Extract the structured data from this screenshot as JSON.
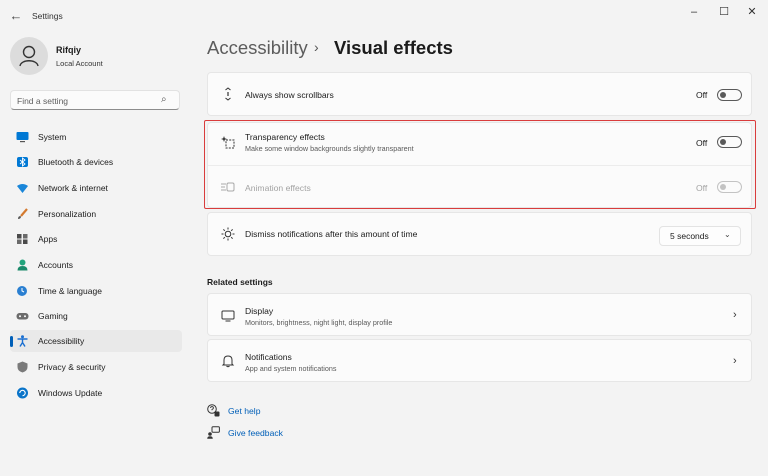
{
  "window": {
    "title": "Settings",
    "controls": [
      "minimize-icon",
      "maximize-icon",
      "close-icon"
    ]
  },
  "profile": {
    "name": "Rifqiy",
    "account_type": "Local Account"
  },
  "search": {
    "placeholder": "Find a setting"
  },
  "nav": {
    "items": [
      {
        "label": "System",
        "icon": "monitor-icon",
        "color": "#0078d4"
      },
      {
        "label": "Bluetooth & devices",
        "icon": "bluetooth-icon",
        "color": "#0078d4"
      },
      {
        "label": "Network & internet",
        "icon": "wifi-icon",
        "color": "#1a86d9"
      },
      {
        "label": "Personalization",
        "icon": "brush-icon",
        "color": "#d47a2f"
      },
      {
        "label": "Apps",
        "icon": "apps-icon",
        "color": "#4a4a4a"
      },
      {
        "label": "Accounts",
        "icon": "person-icon",
        "color": "#21a37c"
      },
      {
        "label": "Time & language",
        "icon": "globe-clock-icon",
        "color": "#2a7fd1"
      },
      {
        "label": "Gaming",
        "icon": "gamepad-icon",
        "color": "#6b6b6b"
      },
      {
        "label": "Accessibility",
        "icon": "accessibility-icon",
        "color": "#1a6fd1",
        "active": true
      },
      {
        "label": "Privacy & security",
        "icon": "shield-icon",
        "color": "#7a7a7a"
      },
      {
        "label": "Windows Update",
        "icon": "update-icon",
        "color": "#0a74c9"
      }
    ]
  },
  "breadcrumb": {
    "parent": "Accessibility",
    "separator": "›",
    "current": "Visual effects"
  },
  "settings": {
    "scrollbars": {
      "title": "Always show scrollbars",
      "state": "Off"
    },
    "transparency": {
      "title": "Transparency effects",
      "description": "Make some window backgrounds slightly transparent",
      "state": "Off"
    },
    "animation": {
      "title": "Animation effects",
      "state": "Off",
      "disabled": true
    },
    "notifications_time": {
      "title": "Dismiss notifications after this amount of time",
      "value": "5 seconds"
    }
  },
  "related": {
    "heading": "Related settings",
    "display": {
      "title": "Display",
      "description": "Monitors, brightness, night light, display profile"
    },
    "notifications": {
      "title": "Notifications",
      "description": "App and system notifications"
    }
  },
  "links": {
    "help": "Get help",
    "feedback": "Give feedback"
  },
  "colors": {
    "accent": "#005fb8",
    "highlight": "#d93c3c",
    "background": "#f3f3f3",
    "card": "#fbfbfb"
  }
}
